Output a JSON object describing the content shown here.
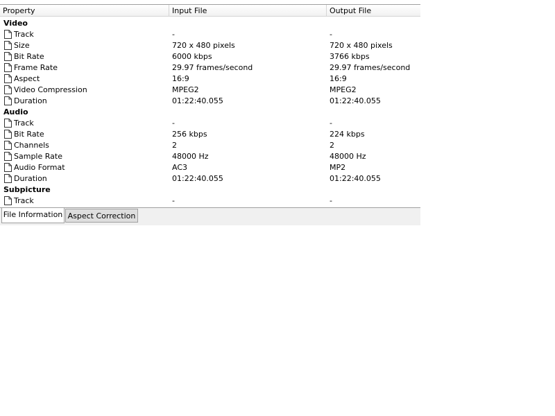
{
  "columns": {
    "property": "Property",
    "input": "Input File",
    "output": "Output File"
  },
  "groups": {
    "video": {
      "title": "Video",
      "rows": [
        {
          "label": "Track",
          "input": "-",
          "output": "-"
        },
        {
          "label": "Size",
          "input": "720 x 480 pixels",
          "output": "720 x 480 pixels"
        },
        {
          "label": "Bit Rate",
          "input": "6000 kbps",
          "output": "3766 kbps"
        },
        {
          "label": "Frame Rate",
          "input": "29.97 frames/second",
          "output": "29.97 frames/second"
        },
        {
          "label": "Aspect",
          "input": "16:9",
          "output": "16:9"
        },
        {
          "label": "Video Compression",
          "input": "MPEG2",
          "output": "MPEG2"
        },
        {
          "label": "Duration",
          "input": "01:22:40.055",
          "output": "01:22:40.055"
        }
      ]
    },
    "audio": {
      "title": "Audio",
      "rows": [
        {
          "label": "Track",
          "input": "-",
          "output": "-"
        },
        {
          "label": "Bit Rate",
          "input": "256 kbps",
          "output": "224 kbps"
        },
        {
          "label": "Channels",
          "input": "2",
          "output": "2"
        },
        {
          "label": "Sample Rate",
          "input": "48000 Hz",
          "output": "48000 Hz"
        },
        {
          "label": "Audio Format",
          "input": "AC3",
          "output": "MP2"
        },
        {
          "label": "Duration",
          "input": "01:22:40.055",
          "output": "01:22:40.055"
        }
      ]
    },
    "subpicture": {
      "title": "Subpicture",
      "rows": [
        {
          "label": "Track",
          "input": "-",
          "output": "-"
        }
      ]
    }
  },
  "tabs": {
    "file_information": "File Information",
    "aspect_correction": "Aspect Correction"
  },
  "icons": {
    "row_icon": "document-icon"
  }
}
